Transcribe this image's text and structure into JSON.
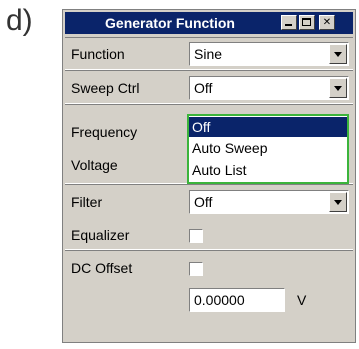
{
  "figure_label": "d)",
  "window": {
    "title": "Generator Function"
  },
  "rows": {
    "function": {
      "label": "Function",
      "value": "Sine"
    },
    "sweep_ctrl": {
      "label": "Sweep Ctrl",
      "value": "Off"
    },
    "frequency": {
      "label": "Frequency"
    },
    "voltage": {
      "label": "Voltage"
    },
    "filter": {
      "label": "Filter",
      "value": "Off"
    },
    "equalizer": {
      "label": "Equalizer",
      "checked": false
    },
    "dc_offset": {
      "label": "DC Offset",
      "checked": false,
      "value": "0.00000",
      "unit": "V"
    }
  },
  "sweep_dropdown": {
    "options": [
      "Off",
      "Auto Sweep",
      "Auto List"
    ],
    "selected_index": 0,
    "border_color": "#3bb43b"
  },
  "colors": {
    "titlebar": "#0a246a",
    "panel": "#d4d0c8",
    "highlight": "#0a246a"
  }
}
